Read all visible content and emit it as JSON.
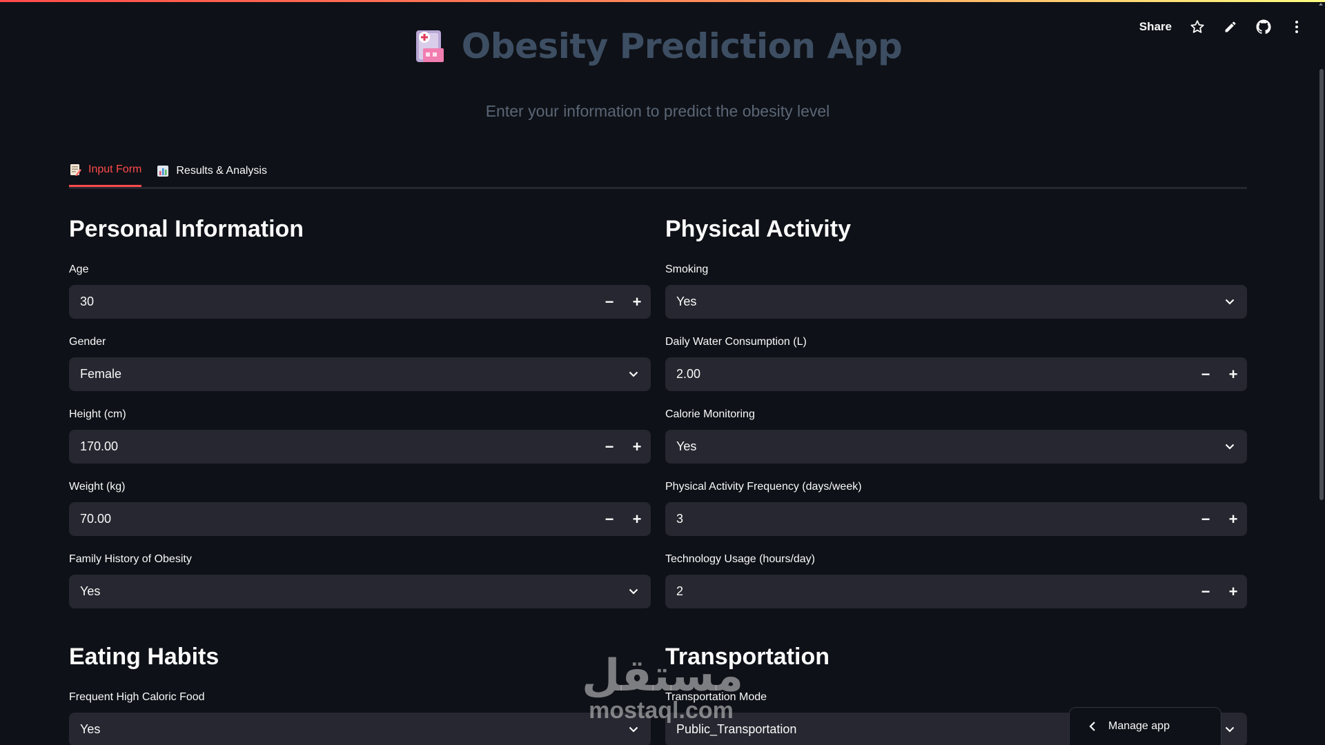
{
  "app": {
    "title": "Obesity Prediction App",
    "subtitle": "Enter your information to predict the obesity level"
  },
  "toolbar": {
    "share_label": "Share",
    "icons": [
      "star-icon",
      "pencil-icon",
      "github-icon",
      "more-vertical-icon"
    ]
  },
  "tabs": [
    {
      "label": "Input Form",
      "icon": "memo-icon",
      "active": true
    },
    {
      "label": "Results & Analysis",
      "icon": "bar-chart-icon",
      "active": false
    }
  ],
  "personal": {
    "title": "Personal Information",
    "age": {
      "label": "Age",
      "value": "30"
    },
    "gender": {
      "label": "Gender",
      "value": "Female"
    },
    "height": {
      "label": "Height (cm)",
      "value": "170.00"
    },
    "weight": {
      "label": "Weight (kg)",
      "value": "70.00"
    },
    "family_history": {
      "label": "Family History of Obesity",
      "value": "Yes"
    }
  },
  "physical": {
    "title": "Physical Activity",
    "smoking": {
      "label": "Smoking",
      "value": "Yes"
    },
    "water": {
      "label": "Daily Water Consumption (L)",
      "value": "2.00"
    },
    "calorie_monitoring": {
      "label": "Calorie Monitoring",
      "value": "Yes"
    },
    "activity_freq": {
      "label": "Physical Activity Frequency (days/week)",
      "value": "3"
    },
    "tech_usage": {
      "label": "Technology Usage (hours/day)",
      "value": "2"
    }
  },
  "eating": {
    "title": "Eating Habits",
    "high_caloric": {
      "label": "Frequent High Caloric Food",
      "value": "Yes"
    }
  },
  "transportation": {
    "title": "Transportation",
    "mode": {
      "label": "Transportation Mode",
      "value": "Public_Transportation"
    }
  },
  "watermark": {
    "arabic": "مستقل",
    "latin": "mostaql.com"
  },
  "manage_app": {
    "label": "Manage app"
  },
  "colors": {
    "accent": "#ff4b4b",
    "background": "#0e1117",
    "input_bg": "#262730",
    "title": "#3d4e63"
  }
}
